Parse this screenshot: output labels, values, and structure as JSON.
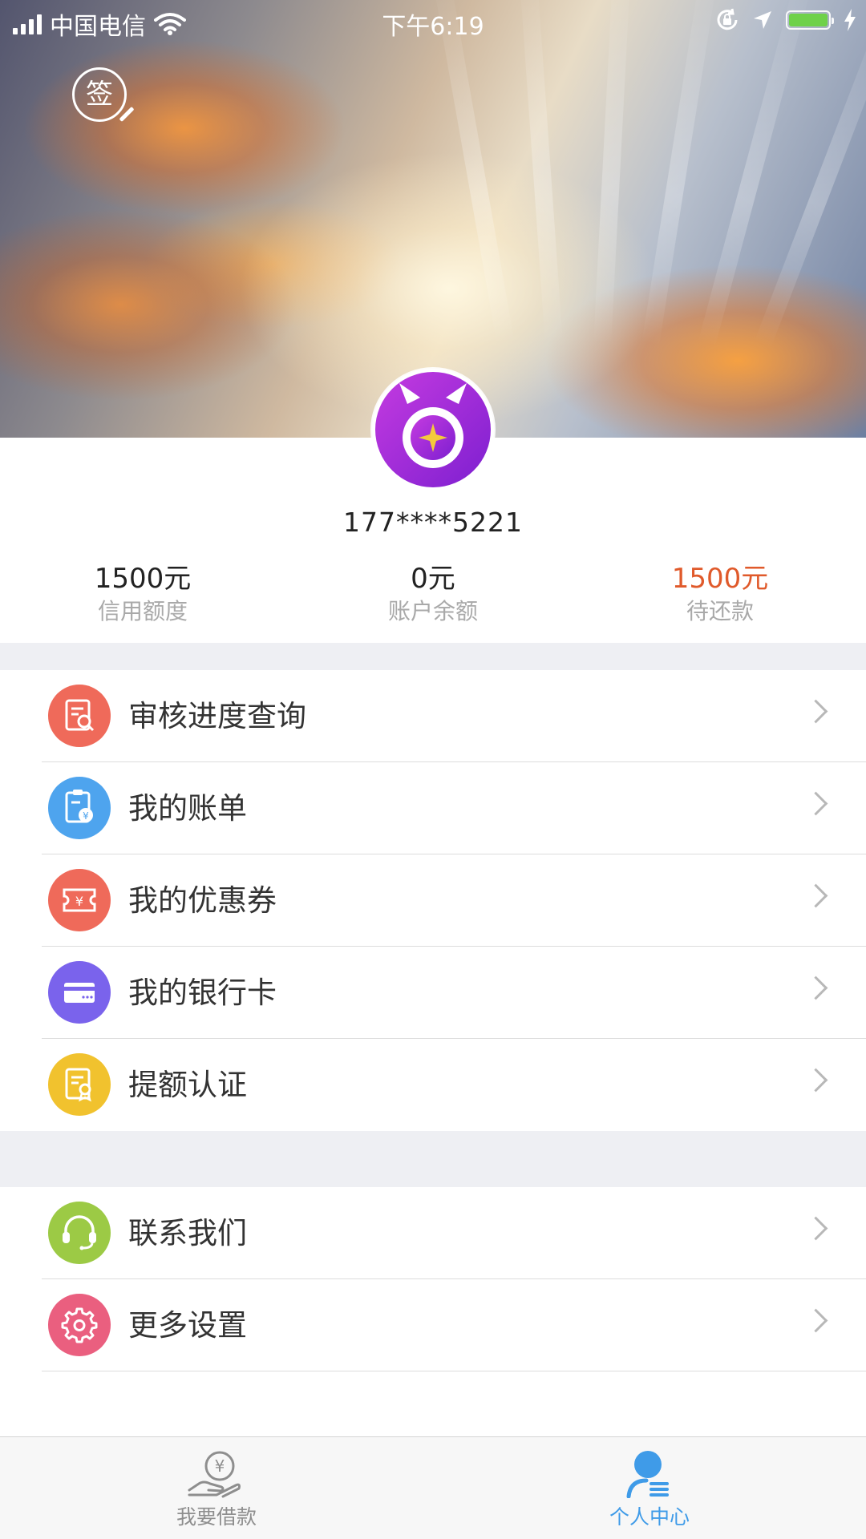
{
  "status_bar": {
    "carrier": "中国电信",
    "time": "下午6:19"
  },
  "header": {
    "sign_in_label": "签"
  },
  "profile": {
    "phone": "177****5221"
  },
  "stats": [
    {
      "value": "1500元",
      "label": "信用额度"
    },
    {
      "value": "0元",
      "label": "账户余额"
    },
    {
      "value": "1500元",
      "label": "待还款"
    }
  ],
  "menu": {
    "group1": [
      {
        "label": "审核进度查询",
        "icon": "review-search-icon",
        "color": "#ef6a5a"
      },
      {
        "label": "我的账单",
        "icon": "bill-icon",
        "color": "#4ea4ee"
      },
      {
        "label": "我的优惠券",
        "icon": "coupon-icon",
        "color": "#ef6a5a"
      },
      {
        "label": "我的银行卡",
        "icon": "bank-card-icon",
        "color": "#7a63ec"
      },
      {
        "label": "提额认证",
        "icon": "certification-icon",
        "color": "#f1c22e"
      }
    ],
    "group2": [
      {
        "label": "联系我们",
        "icon": "headset-icon",
        "color": "#9cca45"
      },
      {
        "label": "更多设置",
        "icon": "settings-gear-icon",
        "color": "#ea5f7f"
      }
    ]
  },
  "tab_bar": {
    "tabs": [
      {
        "label": "我要借款",
        "icon": "loan-hand-icon",
        "active": false
      },
      {
        "label": "个人中心",
        "icon": "user-center-icon",
        "active": true
      }
    ],
    "active_color": "#3f9be8",
    "inactive_color": "#8e8e8e"
  },
  "colors": {
    "due_amount": "#e05a2b",
    "avatar_purple": "#9b2bd8"
  }
}
